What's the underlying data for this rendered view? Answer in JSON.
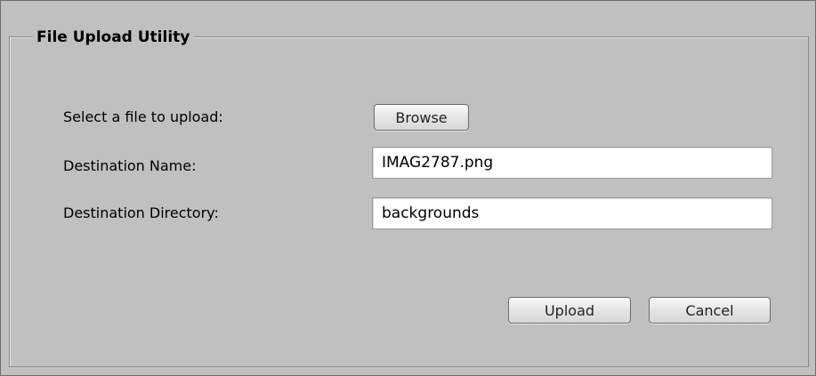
{
  "dialog": {
    "title": "File Upload Utility"
  },
  "form": {
    "file_label": "Select a file to upload:",
    "browse_label": "Browse",
    "dest_name_label": "Destination Name:",
    "dest_name_value": "IMAG2787.png",
    "dest_dir_label": "Destination Directory:",
    "dest_dir_value": "backgrounds"
  },
  "actions": {
    "upload_label": "Upload",
    "cancel_label": "Cancel"
  }
}
